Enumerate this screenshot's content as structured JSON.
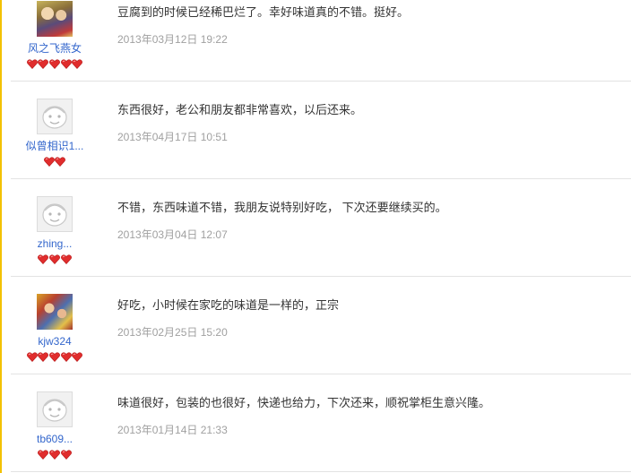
{
  "colors": {
    "username": "#3366cc",
    "review_text": "#333333",
    "date": "#a0a0a0",
    "heart": "#e02d2d",
    "left_border": "#f3c100",
    "separator": "#e3e3e3"
  },
  "reviews": [
    {
      "avatar": "user-photo",
      "username": "风之飞燕女",
      "hearts": 5,
      "text": "豆腐到的时候已经稀巴烂了。幸好味道真的不错。挺好。",
      "date": "2013年03月12日 19:22"
    },
    {
      "avatar": "default-avatar-icon",
      "username": "似曾相识1...",
      "hearts": 2,
      "text": "东西很好，老公和朋友都非常喜欢，以后还来。",
      "date": "2013年04月17日 10:51"
    },
    {
      "avatar": "default-avatar-icon",
      "username": "zhing...",
      "hearts": 3,
      "text": "不错，东西味道不错，我朋友说特别好吃， 下次还要继续买的。",
      "date": "2013年03月04日 12:07"
    },
    {
      "avatar": "user-photo",
      "username": "kjw324",
      "hearts": 5,
      "text": "好吃，小时候在家吃的味道是一样的，正宗",
      "date": "2013年02月25日 15:20"
    },
    {
      "avatar": "default-avatar-icon",
      "username": "tb609...",
      "hearts": 3,
      "text": "味道很好，包装的也很好，快递也给力，下次还来，顺祝掌柜生意兴隆。",
      "date": "2013年01月14日 21:33"
    }
  ]
}
